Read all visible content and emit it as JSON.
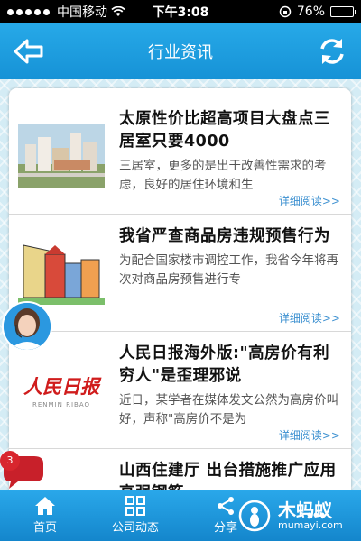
{
  "status_bar": {
    "carrier": "中国移动",
    "time": "下午3:08",
    "battery": "76%",
    "battery_level": 0.76
  },
  "header": {
    "title": "行业资讯"
  },
  "articles": [
    {
      "title": "太原性价比超高项目大盘点三居室只要4000",
      "summary": "三居室，更多的是出于改善性需求的考虑，良好的居住环境和生",
      "more": "详细阅读>>"
    },
    {
      "title": "我省严查商品房违规预售行为",
      "summary": "为配合国家楼市调控工作，我省今年将再次对商品房预售进行专",
      "more": "详细阅读>>"
    },
    {
      "title": "人民日报海外版:\"高房价有利穷人\"是歪理邪说",
      "summary": "近日，某学者在媒体发文公然为高房价叫好，声称\"高房价不是为",
      "more": "详细阅读>>",
      "thumb_logo": "人民日报",
      "thumb_sub": "RENMIN RIBAO"
    },
    {
      "title": "山西住建厅 出台措施推广应用高强钢筋",
      "summary": "",
      "more": ""
    }
  ],
  "chat_badge": "3",
  "tabs": [
    {
      "label": "首页",
      "icon": "home-icon"
    },
    {
      "label": "公司动态",
      "icon": "grid-icon"
    },
    {
      "label": "分享",
      "icon": "share-icon"
    },
    {
      "label": "",
      "icon": "more-icon"
    }
  ],
  "watermark": {
    "name": "木蚂蚁",
    "url": "mumayi.com"
  },
  "colors": {
    "accent": "#1a98dc",
    "link": "#3a8fd0",
    "badge": "#d8262e"
  }
}
